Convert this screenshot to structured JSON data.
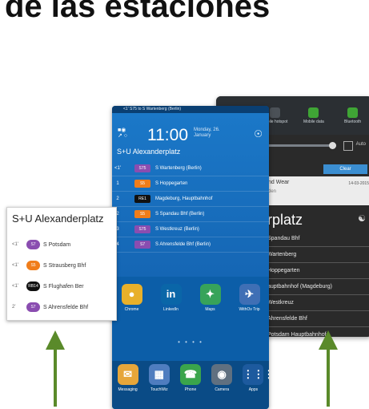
{
  "heading": "de las estaciones",
  "colors": {
    "s_purple": "#8a4db0",
    "s_orange": "#f07d1a",
    "rb_black": "#111111",
    "re_black": "#111111",
    "arrow": "#5a8a2a",
    "accent": "#1566b4"
  },
  "back_phone": {
    "quick_settings": [
      "",
      "Mobile hotspot",
      "Mobile data",
      "Bluetooth"
    ],
    "auto_label": "Auto",
    "clear_label": "Clear",
    "notification": {
      "title": "nd Wear",
      "subtitle": "den",
      "date": "14-03-2015"
    },
    "station_title": "rplatz",
    "rows": [
      "Spandau Bhf",
      "Wartenberg",
      "Hoppegarten",
      "auptbahnhof (Magdeburg)",
      "Westkreuz",
      "Ahrensfelde Bhf",
      "Potsdam Hauptbahnhof"
    ]
  },
  "mid_phone": {
    "status_text": "<1'  S75 to S Wartenberg (Berlin)",
    "time": "11:00",
    "date": "Monday, 26. January",
    "station": "S+U Alexanderplatz",
    "departures": [
      {
        "time": "<1'",
        "line": "S75",
        "dest": "S Wartenberg (Berlin)",
        "color": "#8a4db0"
      },
      {
        "time": "1",
        "line": "S5",
        "dest": "S Hoppegarten",
        "color": "#f07d1a"
      },
      {
        "time": "2",
        "line": "RE1",
        "dest": "Magdeburg, Hauptbahnhof",
        "color": "#111111"
      },
      {
        "time": "2",
        "line": "S5",
        "dest": "S Spandau Bhf (Berlin)",
        "color": "#f07d1a"
      },
      {
        "time": "3",
        "line": "S75",
        "dest": "S Westkreuz (Berlin)",
        "color": "#8a4db0"
      },
      {
        "time": "4",
        "line": "S7",
        "dest": "S Ahrensfelde Bhf (Berlin)",
        "color": "#8a4db0"
      }
    ],
    "apps": [
      {
        "label": "Chrome",
        "icon": "chrome-icon",
        "glyph": "●",
        "color": "#e8b02a"
      },
      {
        "label": "LinkedIn",
        "icon": "linkedin-icon",
        "glyph": "in",
        "color": "#0a66a8"
      },
      {
        "label": "Maps",
        "icon": "maps-icon",
        "glyph": "✦",
        "color": "#37a35a"
      },
      {
        "label": "WithOv Trip",
        "icon": "trip-icon",
        "glyph": "✈",
        "color": "#3f6fb5"
      }
    ],
    "dots": "• • • •",
    "dock": [
      {
        "label": "Messaging",
        "icon": "messaging-icon",
        "glyph": "✉",
        "color": "#e6a63a"
      },
      {
        "label": "TouchWiz",
        "icon": "touchwiz-icon",
        "glyph": "▦",
        "color": "#4f7dbf"
      },
      {
        "label": "Phone",
        "icon": "phone-icon",
        "glyph": "☎",
        "color": "#3aa54b"
      },
      {
        "label": "Camera",
        "icon": "camera-icon",
        "glyph": "◉",
        "color": "#607080"
      },
      {
        "label": "Apps",
        "icon": "apps-grid-icon",
        "glyph": "⋮⋮⋮",
        "color": "#1d5a9e"
      }
    ]
  },
  "card": {
    "title": "S+U Alexanderplatz",
    "rows": [
      {
        "time": "<1'",
        "line": "S7",
        "dest": "S Potsdam",
        "color": "#8a4db0"
      },
      {
        "time": "<1'",
        "line": "S5",
        "dest": "S Strausberg Bhf",
        "color": "#f07d1a"
      },
      {
        "time": "<1'",
        "line": "RB14",
        "dest": "S Flughafen Ber",
        "color": "#111111"
      },
      {
        "time": "2'",
        "line": "S7",
        "dest": "S Ahrensfelde Bhf",
        "color": "#8a4db0"
      }
    ]
  }
}
